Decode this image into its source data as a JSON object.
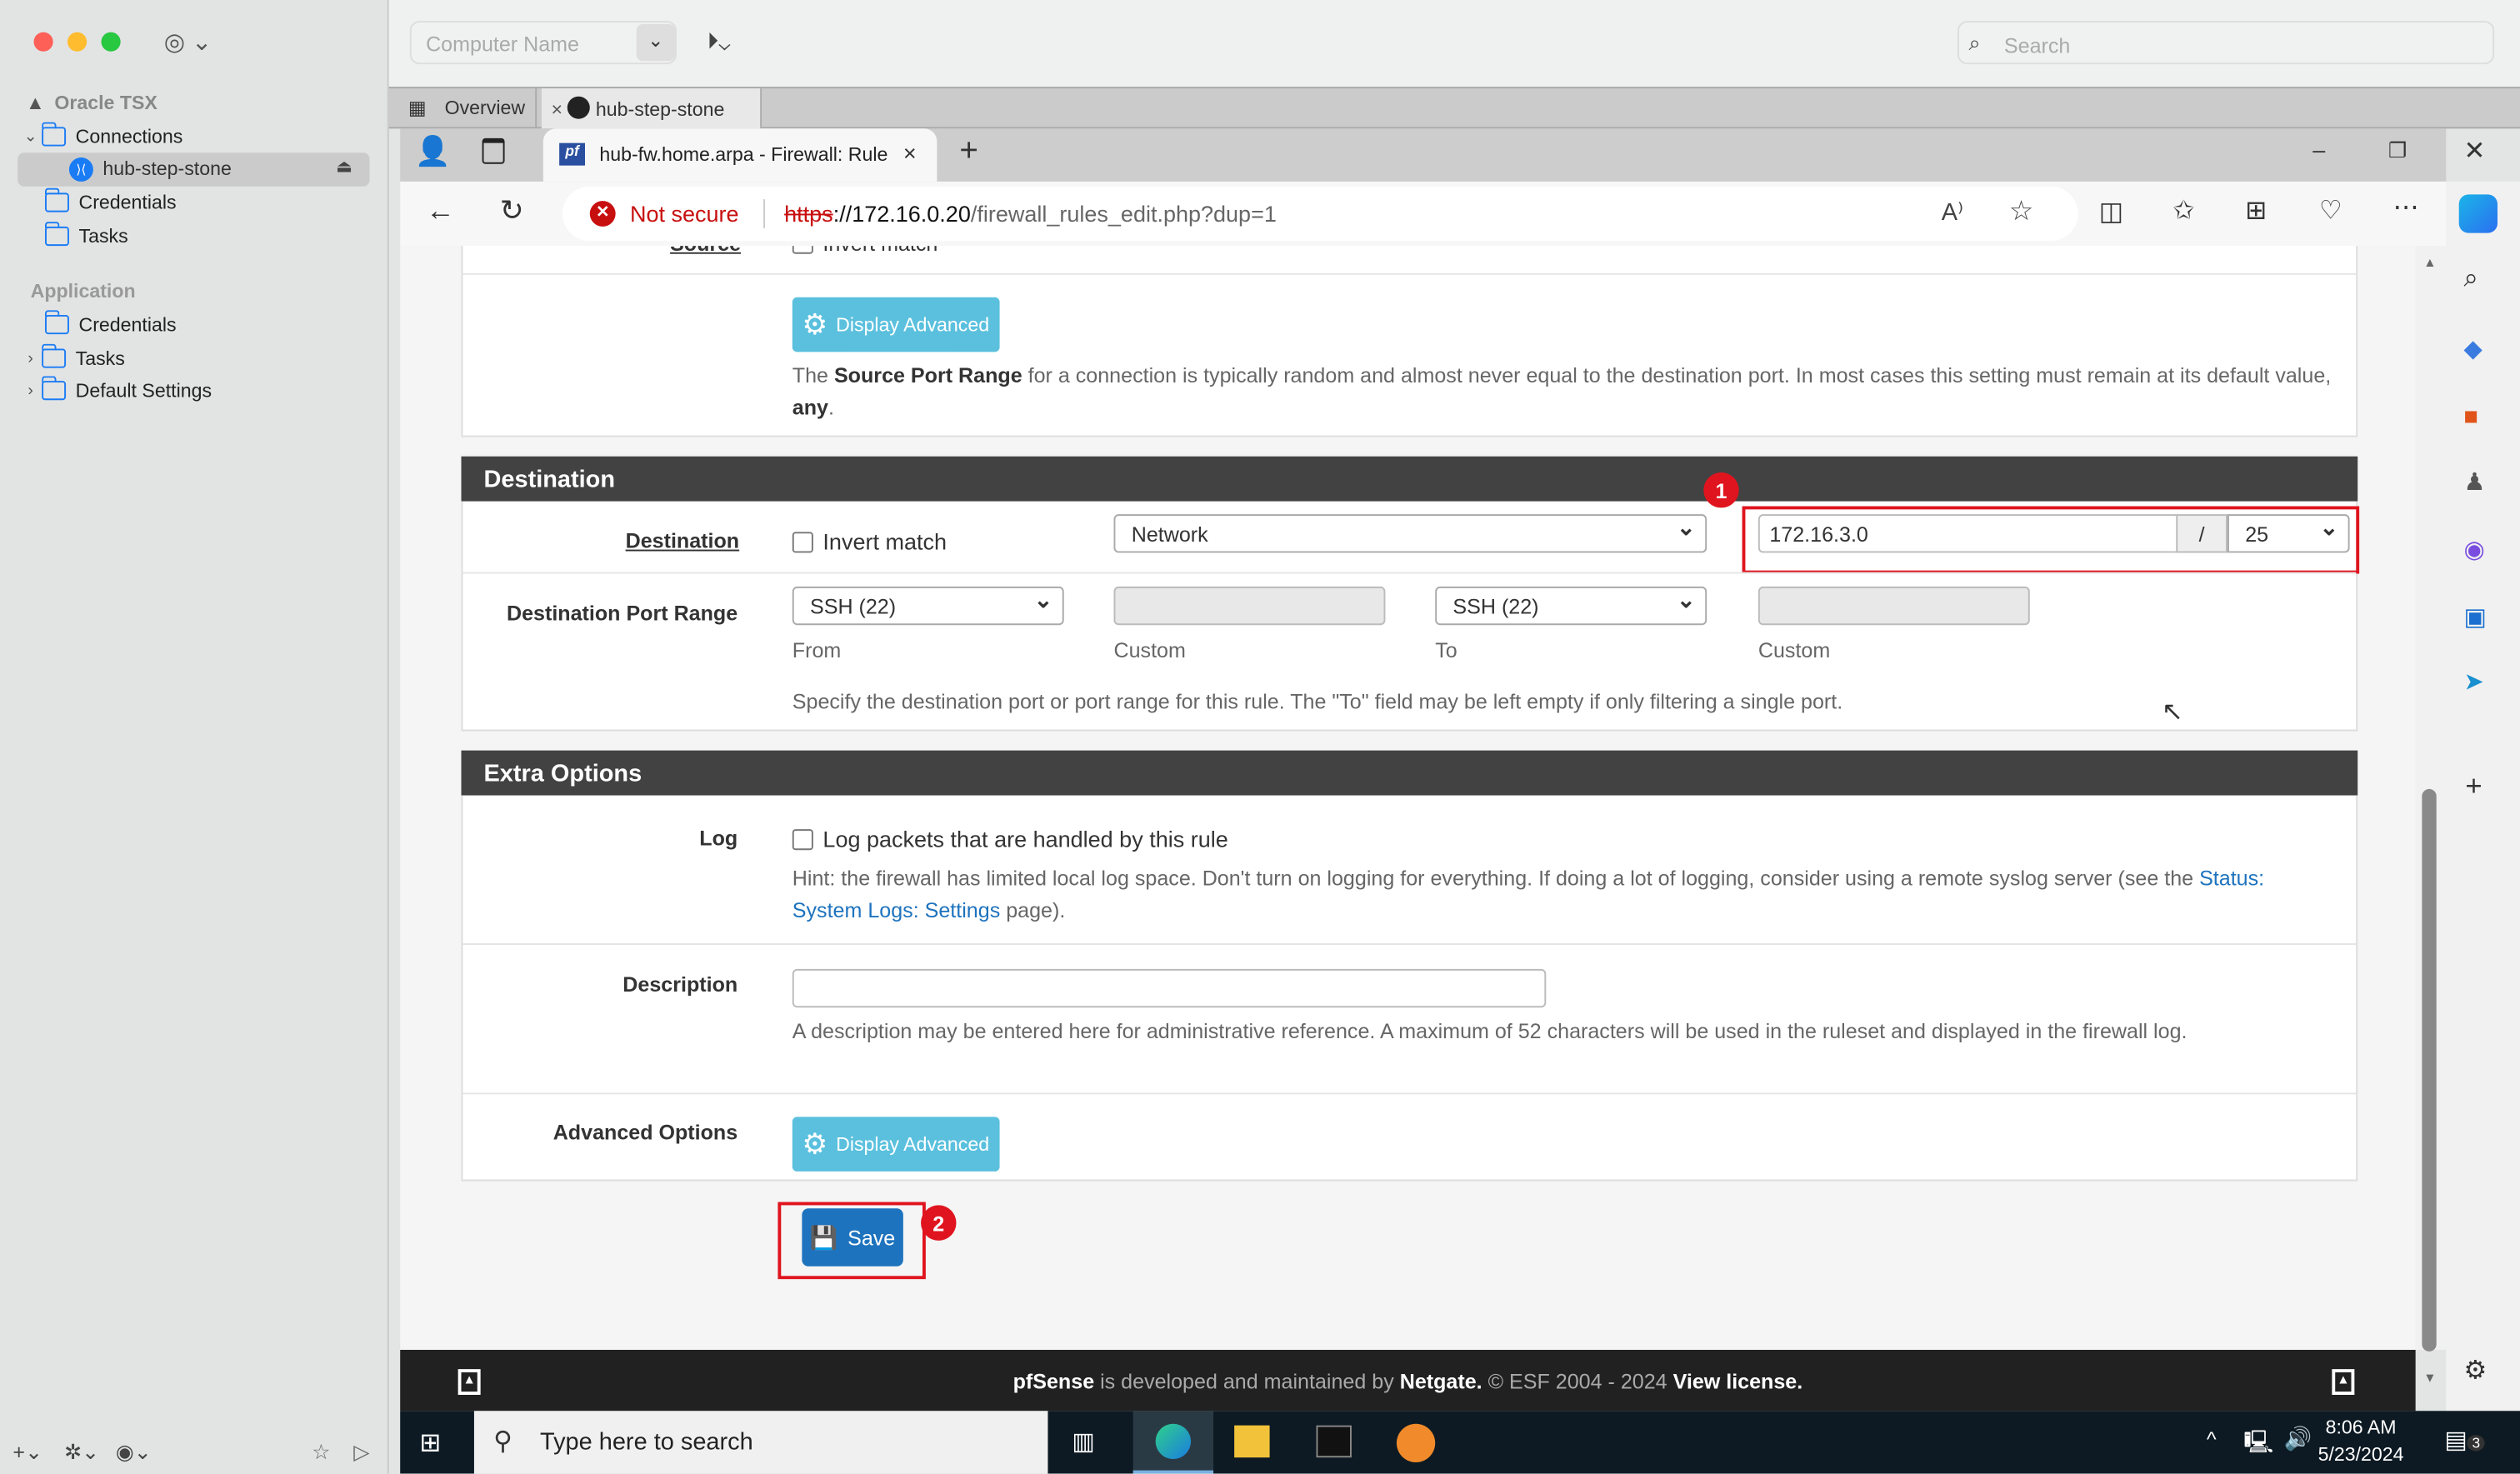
{
  "app": {
    "sidebar": {
      "group1": "Oracle TSX",
      "connections": "Connections",
      "active_connection": "hub-step-stone",
      "credentials": "Credentials",
      "tasks": "Tasks",
      "section2": "Application",
      "app_credentials": "Credentials",
      "app_tasks": "Tasks",
      "default_settings": "Default Settings"
    },
    "toolbar": {
      "computer_name_placeholder": "Computer Name",
      "search_placeholder": "Search"
    },
    "tabs": [
      {
        "label": "Overview"
      },
      {
        "label": "hub-step-stone"
      }
    ]
  },
  "browser": {
    "tab_title": "hub-fw.home.arpa - Firewall: Rule",
    "not_secure": "Not secure",
    "url_scheme": "https",
    "url_host": "://172.16.0.20",
    "url_path": "/firewall_rules_edit.php?dup=1"
  },
  "page": {
    "source": {
      "label": "Source",
      "invert": "Invert match",
      "display_advanced": "Display Advanced",
      "help_pre": "The ",
      "help_bold": "Source Port Range",
      "help_mid": " for a connection is typically random and almost never equal to the destination port. In most cases this setting must remain at its default value, ",
      "help_any": "any",
      "help_end": "."
    },
    "destination": {
      "header": "Destination",
      "label": "Destination",
      "invert": "Invert match",
      "type": "Network",
      "address": "172.16.3.0",
      "slash": "/",
      "mask": "25",
      "port_label": "Destination Port Range",
      "from": "SSH (22)",
      "from_label": "From",
      "custom_label": "Custom",
      "to": "SSH (22)",
      "to_label": "To",
      "custom2_label": "Custom",
      "port_help": "Specify the destination port or port range for this rule. The \"To\" field may be left empty if only filtering a single port."
    },
    "extra": {
      "header": "Extra Options",
      "log_label": "Log",
      "log_text": "Log packets that are handled by this rule",
      "log_hint": "Hint: the firewall has limited local log space. Don't turn on logging for everything. If doing a lot of logging, consider using a remote syslog server (see the ",
      "log_link": "Status: System Logs: Settings",
      "log_hint_end": " page).",
      "desc_label": "Description",
      "desc_value": "",
      "desc_help": "A description may be entered here for administrative reference. A maximum of 52 characters will be used in the ruleset and displayed in the firewall log.",
      "adv_label": "Advanced Options",
      "adv_button": "Display Advanced"
    },
    "save": "Save",
    "annotations": [
      "1",
      "2"
    ],
    "footer": {
      "pfsense": "pfSense",
      "mid": " is developed and maintained by ",
      "netgate": "Netgate.",
      "copy": " © ESF 2004 - 2024 ",
      "license": "View license."
    }
  },
  "taskbar": {
    "search_placeholder": "Type here to search",
    "time": "8:06 AM",
    "date": "5/23/2024",
    "notifications": "3"
  },
  "colors": {
    "accent": "#1e73be",
    "highlight": "#e0141e",
    "header": "#424242",
    "info_button": "#5bc0de"
  }
}
